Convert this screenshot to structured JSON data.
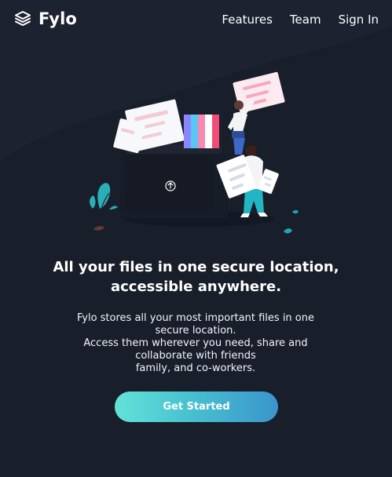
{
  "header": {
    "brand": "Fylo",
    "nav": [
      {
        "label": "Features"
      },
      {
        "label": "Team"
      },
      {
        "label": "Sign In"
      }
    ]
  },
  "hero": {
    "title_line_1": "All your files in one secure location,",
    "title_line_2": "accessible anywhere.",
    "description_lines": [
      "Fylo stores all your most important files in one",
      "secure location.",
      "Access them wherever you need, share and",
      "collaborate with friends",
      "family, and co-workers."
    ],
    "cta_label": "Get Started"
  },
  "colors": {
    "background": "#1c2230",
    "curve_background": "#181e2a",
    "cta_start": "#63e2d8",
    "cta_end": "#3a95cc"
  },
  "icons": {
    "logo": "stack-layers-icon",
    "folder_upload": "upload-arrow-icon"
  }
}
